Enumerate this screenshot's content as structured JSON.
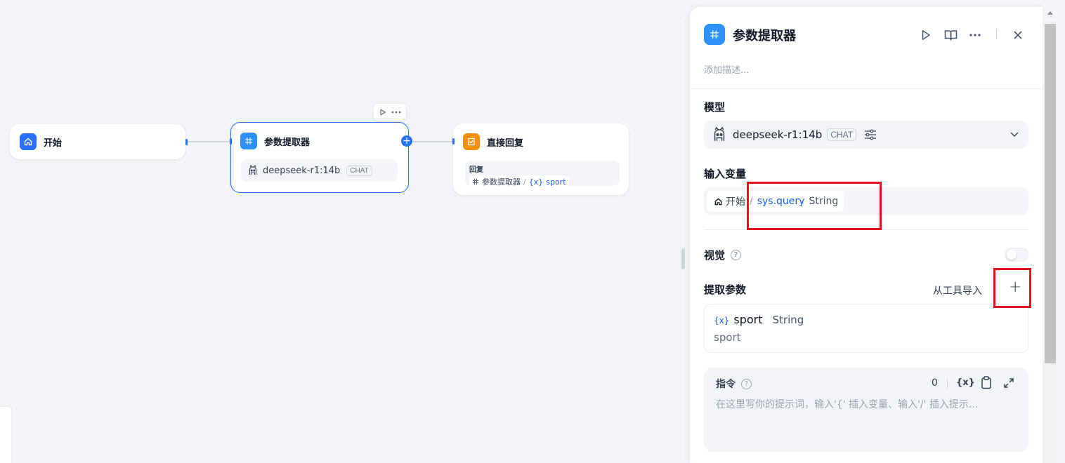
{
  "canvas": {
    "nodes": {
      "start": {
        "title": "开始",
        "icon": "home-icon",
        "color": "#2970ff"
      },
      "extractor": {
        "title": "参数提取器",
        "icon": "grid-icon",
        "color": "#2e90fa",
        "model": "deepseek-r1:14b",
        "model_tag": "CHAT"
      },
      "answer": {
        "title": "直接回复",
        "icon": "reply-icon",
        "color": "#f79009",
        "answer_label": "回复",
        "ref_node": "参数提取器",
        "ref_separator": "/",
        "ref_var_prefix": "{x}",
        "ref_var": "sport"
      }
    }
  },
  "panel": {
    "title": "参数提取器",
    "description_placeholder": "添加描述...",
    "model": {
      "label": "模型",
      "name": "deepseek-r1:14b",
      "tag": "CHAT"
    },
    "input_vars": {
      "label": "输入变量",
      "node": "开始",
      "separator": "/",
      "var": "sys.query",
      "type": "String"
    },
    "vision": {
      "label": "视觉",
      "help": "?",
      "enabled": false
    },
    "extract": {
      "label": "提取参数",
      "import_label": "从工具导入",
      "add_label": "+",
      "params": [
        {
          "prefix": "{x}",
          "name": "sport",
          "type": "String",
          "description": "sport"
        }
      ]
    },
    "instruction": {
      "label": "指令",
      "help": "?",
      "count": "0",
      "var_insert": "{x}",
      "placeholder": "在这里写你的提示词，输入'{' 插入变量、输入'/' 插入提示..."
    }
  },
  "colors": {
    "accent": "#2970ff",
    "highlight": "#e5121c"
  }
}
